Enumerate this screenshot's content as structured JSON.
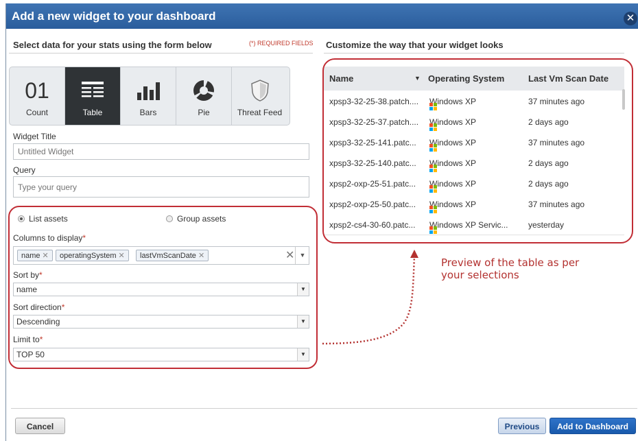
{
  "dialog": {
    "title": "Add a new widget to your dashboard",
    "close_icon": "close-icon"
  },
  "left": {
    "heading": "Select data for your stats using the form below",
    "required_note": "(*) REQUIRED FIELDS",
    "types": [
      {
        "label": "Count",
        "icon": "01",
        "active": false
      },
      {
        "label": "Table",
        "icon": "table-icon",
        "active": true
      },
      {
        "label": "Bars",
        "icon": "bar-chart-icon",
        "active": false
      },
      {
        "label": "Pie",
        "icon": "pie-chart-icon",
        "active": false
      },
      {
        "label": "Threat Feed",
        "icon": "shield-icon",
        "active": false
      }
    ],
    "widget_title": {
      "label": "Widget Title",
      "placeholder": "Untitled Widget"
    },
    "query": {
      "label": "Query",
      "placeholder": "Type your query"
    },
    "radio_list": "List assets",
    "radio_group": "Group assets",
    "columns": {
      "label": "Columns to display",
      "star": "*",
      "tags": [
        "name",
        "operatingSystem",
        "lastVmScanDate"
      ]
    },
    "sort_by": {
      "label": "Sort by",
      "star": "*",
      "value": "name"
    },
    "sort_direction": {
      "label": "Sort direction",
      "star": "*",
      "value": "Descending"
    },
    "limit": {
      "label": "Limit to",
      "star": "*",
      "value": "TOP 50"
    }
  },
  "right": {
    "heading": "Customize the way that your widget looks",
    "table": {
      "headers": [
        "Name",
        "Operating System",
        "Last Vm Scan Date"
      ],
      "rows": [
        [
          "xpsp3-32-25-38.patch....",
          "Windows XP",
          "37 minutes ago"
        ],
        [
          "xpsp3-32-25-37.patch....",
          "Windows XP",
          "2 days ago"
        ],
        [
          "xpsp3-32-25-141.patc...",
          "Windows XP",
          "37 minutes ago"
        ],
        [
          "xpsp3-32-25-140.patc...",
          "Windows XP",
          "2 days ago"
        ],
        [
          "xpsp2-oxp-25-51.patc...",
          "Windows XP",
          "2 days ago"
        ],
        [
          "xpsp2-oxp-25-50.patc...",
          "Windows XP",
          "37 minutes ago"
        ],
        [
          "xpsp2-cs4-30-60.patc...",
          "Windows XP Servic...",
          "yesterday"
        ]
      ]
    },
    "note_line1": "Preview of the table as per",
    "note_line2": "your selections"
  },
  "footer": {
    "cancel": "Cancel",
    "previous": "Previous",
    "add": "Add to Dashboard"
  },
  "colors": {
    "accent": "#2a5d9c",
    "highlight": "#c12d35"
  }
}
